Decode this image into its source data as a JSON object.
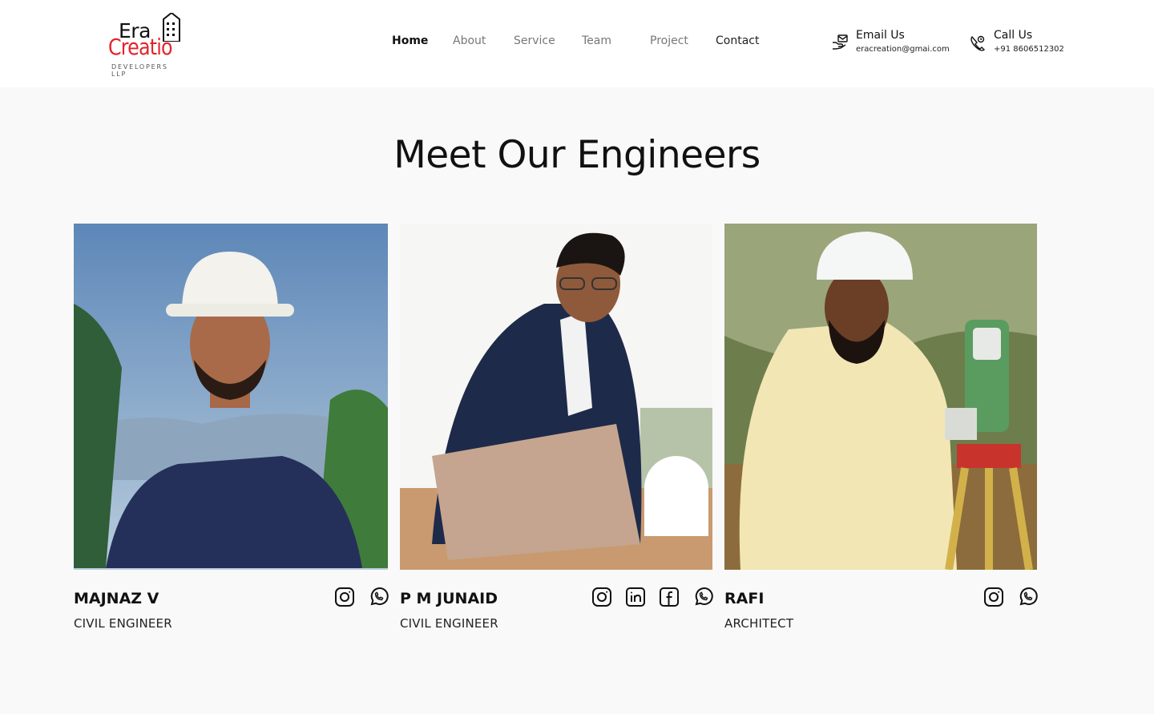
{
  "brand": {
    "logo_line1": "Era",
    "logo_line2": "Creatio",
    "logo_sub": "DEVELOPERS LLP",
    "accent_color": "#e3242b"
  },
  "nav": {
    "items": [
      {
        "label": "Home"
      },
      {
        "label": "About"
      },
      {
        "label": "Service"
      },
      {
        "label": "Team"
      },
      {
        "label": "Project"
      },
      {
        "label": "Contact"
      }
    ]
  },
  "contact": {
    "email": {
      "title": "Email Us",
      "value": "eracreation@gmai.com",
      "icon": "email-hand-icon"
    },
    "phone": {
      "title": "Call Us",
      "value": "+91 8606512302",
      "icon": "phone-call-icon"
    }
  },
  "main": {
    "title": "Meet Our Engineers",
    "engineers": [
      {
        "name": "MAJNAZ V",
        "role": "CIVIL ENGINEER",
        "socials": [
          "instagram-icon",
          "whatsapp-icon"
        ]
      },
      {
        "name": "P M JUNAID",
        "role": "CIVIL ENGINEER",
        "socials": [
          "instagram-icon",
          "linkedin-icon",
          "facebook-icon",
          "whatsapp-icon"
        ]
      },
      {
        "name": "RAFI",
        "role": "ARCHITECT",
        "socials": [
          "instagram-icon",
          "whatsapp-icon"
        ]
      }
    ]
  }
}
